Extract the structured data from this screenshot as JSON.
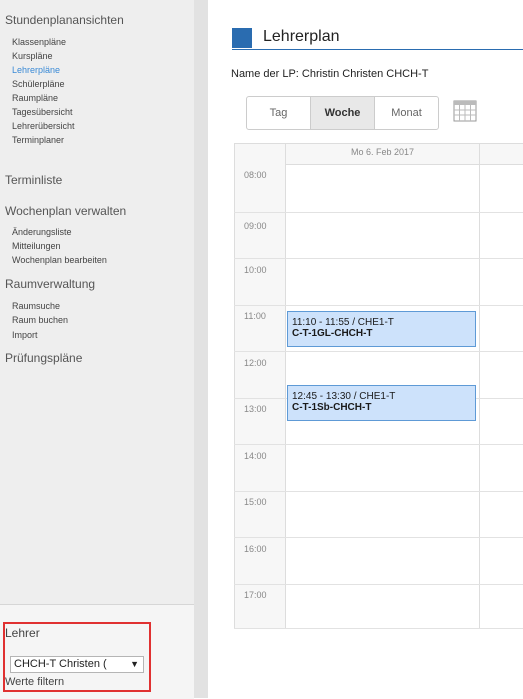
{
  "sidebar": {
    "sections": [
      {
        "id": "stundenplanansichten",
        "label": "Stundenplanansichten"
      },
      {
        "id": "terminliste",
        "label": "Terminliste"
      },
      {
        "id": "wochenplan",
        "label": "Wochenplan verwalten"
      },
      {
        "id": "raumverwaltung",
        "label": "Raumverwaltung"
      },
      {
        "id": "pruefungsplaene",
        "label": "Prüfungspläne"
      }
    ],
    "items": {
      "klassenplaene": "Klassenpläne",
      "kursplaene": "Kurspläne",
      "lehrerplaene": "Lehrerpläne",
      "schuelerplaene": "Schülerpläne",
      "raumplaene": "Raumpläne",
      "tagesuebersicht": "Tagesübersicht",
      "lehreruebersicht": "Lehrerübersicht",
      "terminplaner": "Terminplaner",
      "aenderungsliste": "Änderungsliste",
      "mitteilungen": "Mitteilungen",
      "wochenplan_bearbeiten": "Wochenplan bearbeiten",
      "raumsuche": "Raumsuche",
      "raum_buchen": "Raum buchen",
      "import": "Import"
    },
    "active_item": "Lehrerpläne",
    "filter": {
      "label": "Lehrer",
      "selected_value": "CHCH-T Christen (",
      "filter_link": "Werte filtern"
    }
  },
  "header": {
    "title": "Lehrerplan",
    "lp_name": "Name der LP: Christin Christen CHCH-T"
  },
  "views": {
    "tag": "Tag",
    "woche": "Woche",
    "monat": "Monat",
    "selected": "Woche"
  },
  "calendar": {
    "day_header": "Mo 6. Feb 2017",
    "hours": [
      "08:00",
      "09:00",
      "10:00",
      "11:00",
      "12:00",
      "13:00",
      "14:00",
      "15:00",
      "16:00",
      "17:00"
    ],
    "events": [
      {
        "time": "11:10 - 11:55 / CHE1-T",
        "course": "C-T-1GL-CHCH-T"
      },
      {
        "time": "12:45 - 13:30 / CHE1-T",
        "course": "C-T-1Sb-CHCH-T"
      }
    ]
  },
  "colors": {
    "accent": "#2a6cb0",
    "active_link": "#3a8ad6",
    "event_fill": "#cde2fb",
    "event_border": "#5e9ad6",
    "highlight_box": "#e03131"
  }
}
